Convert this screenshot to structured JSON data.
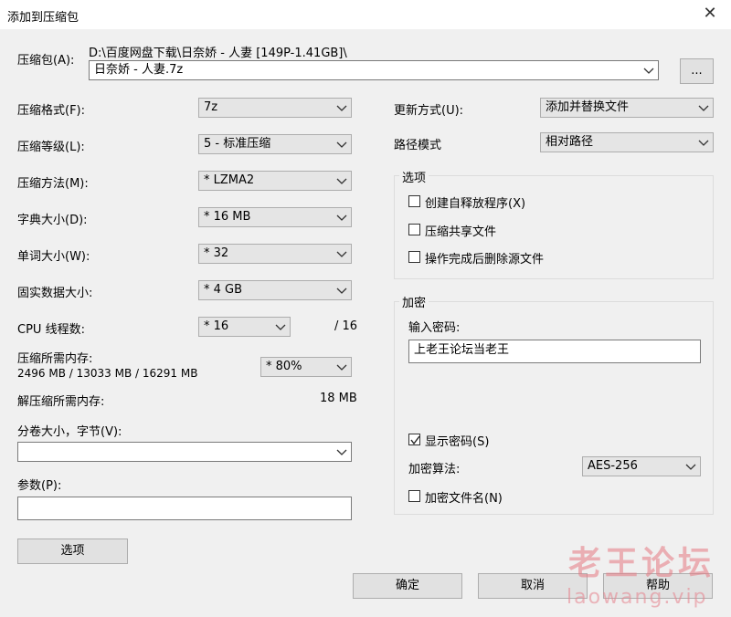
{
  "window": {
    "title": "添加到压缩包"
  },
  "archive": {
    "label": "压缩包(A):",
    "path": "D:\\百度网盘下载\\日奈娇 - 人妻 [149P-1.41GB]\\",
    "name": "日奈娇 - 人妻.7z",
    "browse_label": "..."
  },
  "left": {
    "format": {
      "label": "压缩格式(F):",
      "value": "7z"
    },
    "level": {
      "label": "压缩等级(L):",
      "value": "5 - 标准压缩"
    },
    "method": {
      "label": "压缩方法(M):",
      "value": "* LZMA2"
    },
    "dict": {
      "label": "字典大小(D):",
      "value": "* 16 MB"
    },
    "word": {
      "label": "单词大小(W):",
      "value": "* 32"
    },
    "solid": {
      "label": "固实数据大小:",
      "value": "* 4 GB"
    },
    "threads": {
      "label": "CPU 线程数:",
      "value": "* 16",
      "max": "/ 16"
    },
    "memory": {
      "label": "压缩所需内存:",
      "detail": "2496 MB / 13033 MB / 16291 MB",
      "value": "* 80%"
    },
    "decomp": {
      "label": "解压缩所需内存:",
      "value": "18 MB"
    },
    "split": {
      "label": "分卷大小，字节(V):",
      "value": ""
    },
    "params": {
      "label": "参数(P):",
      "value": ""
    },
    "options_button": "选项"
  },
  "right": {
    "update": {
      "label": "更新方式(U):",
      "value": "添加并替换文件"
    },
    "pathmode": {
      "label": "路径模式",
      "value": "相对路径"
    },
    "options": {
      "title": "选项",
      "sfx": {
        "label": "创建自释放程序(X)",
        "checked": false
      },
      "shared": {
        "label": "压缩共享文件",
        "checked": false
      },
      "delete": {
        "label": "操作完成后删除源文件",
        "checked": false
      }
    },
    "encryption": {
      "title": "加密",
      "password_label": "输入密码:",
      "password_value": "上老王论坛当老王",
      "show_password": {
        "label": "显示密码(S)",
        "checked": true
      },
      "method_label": "加密算法:",
      "method_value": "AES-256",
      "encrypt_names": {
        "label": "加密文件名(N)",
        "checked": false
      }
    }
  },
  "footer": {
    "ok": "确定",
    "cancel": "取消",
    "help": "帮助"
  },
  "watermark": {
    "line1": "老王论坛",
    "line2": "laowang.vip"
  }
}
